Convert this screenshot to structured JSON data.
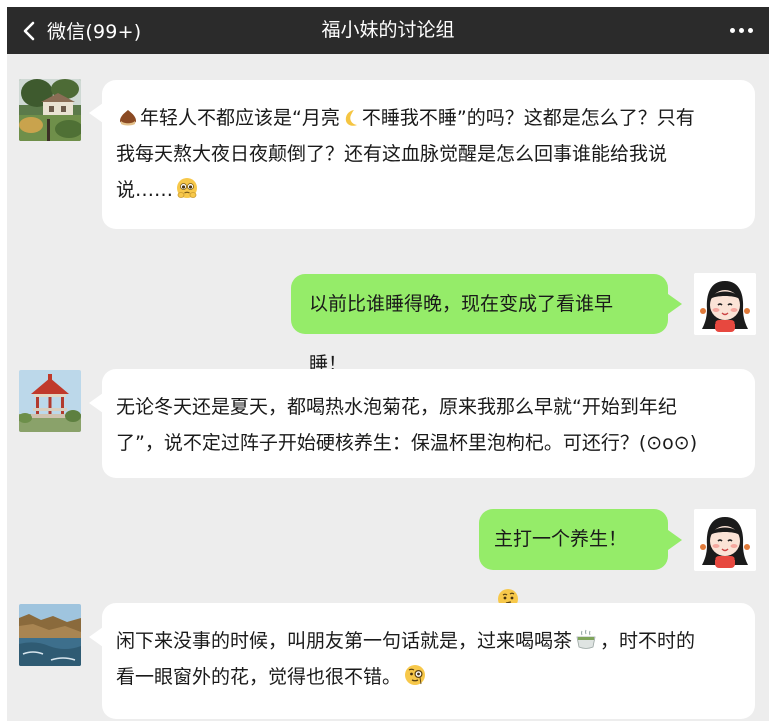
{
  "header": {
    "back_label": "微信(99+)",
    "title": "福小妹的讨论组"
  },
  "messages": [
    {
      "side": "left",
      "avatar": "garden-house-photo",
      "lines": [
        [
          "",
          "年轻人不都应该是“月亮",
          "不睡我不睡”的吗？这都是怎么了？只有"
        ],
        [
          "我每天熬大夜日夜颠倒了？还有这血脉觉醒是怎么回事谁能给我说"
        ],
        [
          "说……"
        ]
      ],
      "icons": [
        "chestnut-emoji-icon",
        "moon-emoji-icon",
        "pleading-face-emoji-icon"
      ]
    },
    {
      "side": "right",
      "avatar": "cartoon-girl-avatar",
      "lines": [
        [
          "以前比谁睡得晚，现在变成了看谁早睡！"
        ]
      ]
    },
    {
      "side": "left",
      "avatar": "red-pavilion-photo",
      "lines": [
        [
          "无论冬天还是夏天，都喝热水泡菊花，原来我那么早就“开始到年纪"
        ],
        [
          "了”，说不定过阵子开始硬核养生：保温杯里泡枸杞。可还行？(⊙o⊙)"
        ]
      ]
    },
    {
      "side": "right",
      "avatar": "cartoon-girl-avatar",
      "lines": [
        [
          "主打一个养生！"
        ]
      ],
      "icons": [
        "thinking-face-emoji-icon"
      ]
    },
    {
      "side": "left",
      "avatar": "seaside-cliff-photo",
      "lines": [
        [
          "闲下来没事的时候，叫朋友第一句话就是，过来喝喝茶",
          "，时不时的"
        ],
        [
          "看一眼窗外的花，觉得也很不错。"
        ]
      ],
      "icons": [
        "tea-cup-emoji-icon",
        "monocle-face-emoji-icon"
      ]
    }
  ]
}
